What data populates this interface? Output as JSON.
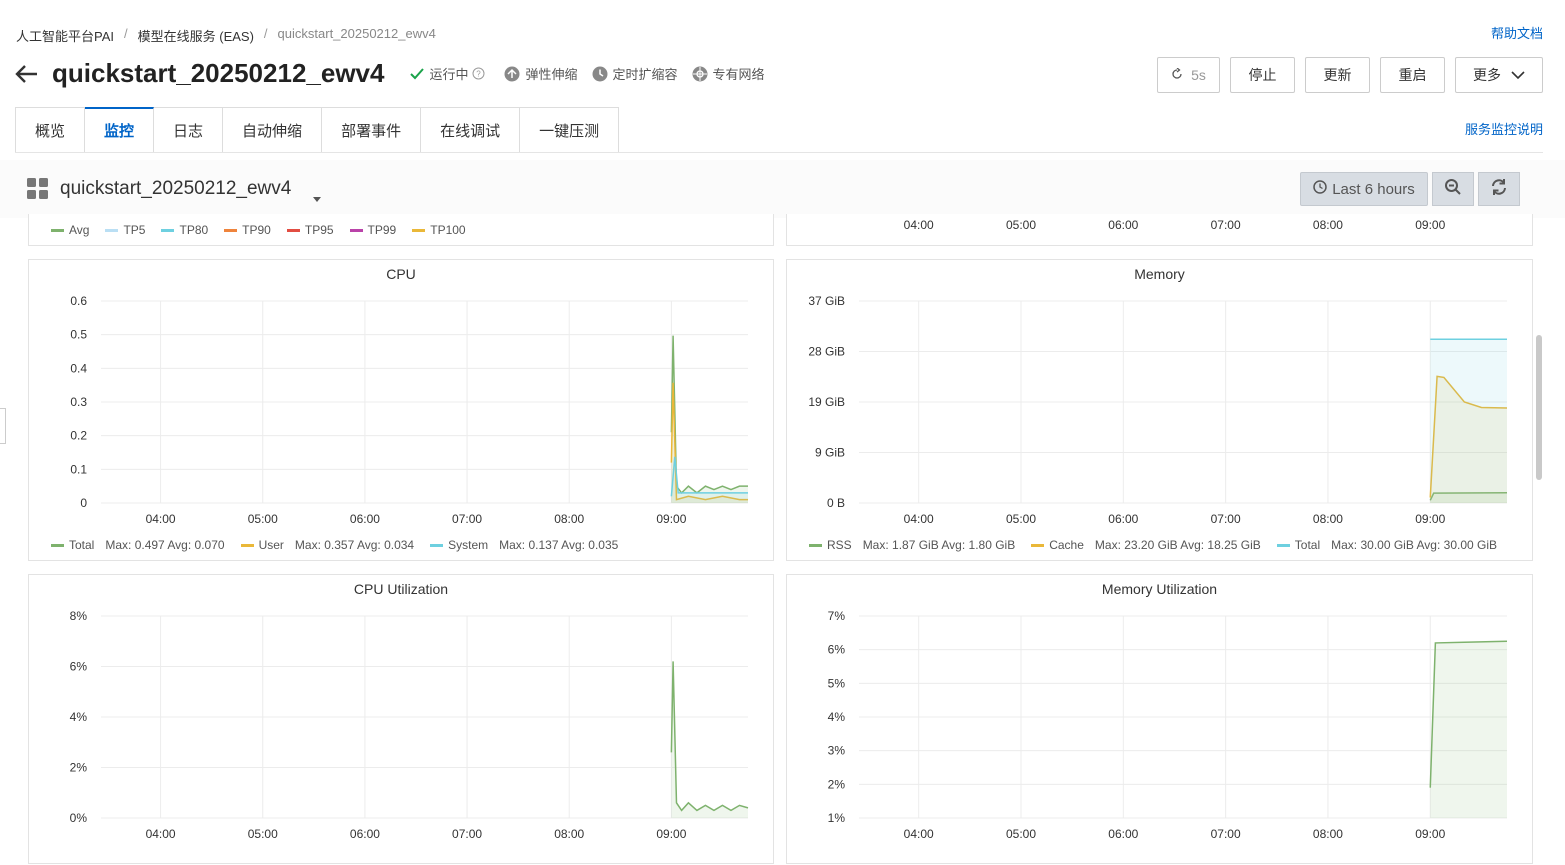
{
  "breadcrumb": {
    "item1": "人工智能平台PAI",
    "sep": "/",
    "item2": "模型在线服务 (EAS)",
    "item3": "quickstart_20250212_ewv4"
  },
  "help_link": "帮助文档",
  "service": {
    "name": "quickstart_20250212_ewv4"
  },
  "status": {
    "running": "运行中",
    "autoscale": "弹性伸缩",
    "scheduled": "定时扩缩容",
    "vpc": "专有网络"
  },
  "buttons": {
    "refresh_interval": "5s",
    "stop": "停止",
    "update": "更新",
    "restart": "重启",
    "more": "更多"
  },
  "tabs": [
    "概览",
    "监控",
    "日志",
    "自动伸缩",
    "部署事件",
    "在线调试",
    "一键压测"
  ],
  "active_tab": "监控",
  "monitor_doc_link": "服务监控说明",
  "dashboard": {
    "title": "quickstart_20250212_ewv4",
    "time_range": "Last 6 hours"
  },
  "colors": {
    "green": "#7eb26d",
    "yellow": "#eab839",
    "cyan": "#6ed0e0",
    "lightblue": "#badff4",
    "orange": "#ef843c",
    "red": "#e24d42",
    "purple": "#ba43a9",
    "link": "#0064c8"
  },
  "x_ticks": [
    "04:00",
    "05:00",
    "06:00",
    "07:00",
    "08:00",
    "09:00"
  ],
  "top_left_legend": [
    {
      "name": "Avg",
      "color": "#7eb26d"
    },
    {
      "name": "TP5",
      "color": "#badff4"
    },
    {
      "name": "TP80",
      "color": "#6ed0e0"
    },
    {
      "name": "TP90",
      "color": "#ef843c"
    },
    {
      "name": "TP95",
      "color": "#e24d42"
    },
    {
      "name": "TP99",
      "color": "#ba43a9"
    },
    {
      "name": "TP100",
      "color": "#eab839"
    }
  ],
  "panels": {
    "cpu": {
      "title": "CPU",
      "legend": [
        {
          "name": "Total",
          "stats": "Max: 0.497   Avg: 0.070",
          "color": "#7eb26d"
        },
        {
          "name": "User",
          "stats": "Max: 0.357   Avg: 0.034",
          "color": "#eab839"
        },
        {
          "name": "System",
          "stats": "Max: 0.137   Avg: 0.035",
          "color": "#6ed0e0"
        }
      ]
    },
    "memory": {
      "title": "Memory",
      "legend": [
        {
          "name": "RSS",
          "stats": "Max: 1.87 GiB   Avg: 1.80 GiB",
          "color": "#7eb26d"
        },
        {
          "name": "Cache",
          "stats": "Max: 23.20 GiB   Avg: 18.25 GiB",
          "color": "#eab839"
        },
        {
          "name": "Total",
          "stats": "Max: 30.00 GiB   Avg: 30.00 GiB",
          "color": "#6ed0e0"
        }
      ]
    },
    "cpu_util": {
      "title": "CPU Utilization"
    },
    "mem_util": {
      "title": "Memory Utilization"
    }
  },
  "chart_data": [
    {
      "type": "line",
      "title": "CPU",
      "x_ticks": [
        "04:00",
        "05:00",
        "06:00",
        "07:00",
        "08:00",
        "09:00"
      ],
      "y_ticks": [
        "0",
        "0.1",
        "0.2",
        "0.3",
        "0.4",
        "0.5",
        "0.6"
      ],
      "ylim": [
        0,
        0.6
      ],
      "series": [
        {
          "name": "Total",
          "color": "#7eb26d",
          "points": [
            [
              "09:00",
              0.21
            ],
            [
              "09:01",
              0.497
            ],
            [
              "09:03",
              0.05
            ],
            [
              "09:06",
              0.03
            ],
            [
              "09:10",
              0.05
            ],
            [
              "09:15",
              0.03
            ],
            [
              "09:20",
              0.05
            ],
            [
              "09:25",
              0.04
            ],
            [
              "09:30",
              0.05
            ],
            [
              "09:35",
              0.04
            ],
            [
              "09:40",
              0.05
            ],
            [
              "09:45",
              0.05
            ]
          ]
        },
        {
          "name": "User",
          "color": "#eab839",
          "points": [
            [
              "09:00",
              0.12
            ],
            [
              "09:01",
              0.357
            ],
            [
              "09:03",
              0.01
            ],
            [
              "09:10",
              0.02
            ],
            [
              "09:20",
              0.01
            ],
            [
              "09:30",
              0.02
            ],
            [
              "09:40",
              0.01
            ],
            [
              "09:45",
              0.01
            ]
          ]
        },
        {
          "name": "System",
          "color": "#6ed0e0",
          "points": [
            [
              "09:00",
              0.02
            ],
            [
              "09:02",
              0.137
            ],
            [
              "09:04",
              0.03
            ],
            [
              "09:10",
              0.03
            ],
            [
              "09:20",
              0.03
            ],
            [
              "09:30",
              0.03
            ],
            [
              "09:40",
              0.03
            ],
            [
              "09:45",
              0.03
            ]
          ]
        }
      ]
    },
    {
      "type": "line",
      "title": "Memory",
      "x_ticks": [
        "04:00",
        "05:00",
        "06:00",
        "07:00",
        "08:00",
        "09:00"
      ],
      "y_ticks": [
        "0 B",
        "9 GiB",
        "19 GiB",
        "28 GiB",
        "37 GiB"
      ],
      "ylim": [
        0,
        37
      ],
      "series": [
        {
          "name": "RSS",
          "color": "#7eb26d",
          "points": [
            [
              "09:00",
              0.5
            ],
            [
              "09:02",
              1.8
            ],
            [
              "09:45",
              1.87
            ]
          ]
        },
        {
          "name": "Cache",
          "color": "#eab839",
          "points": [
            [
              "09:00",
              1.0
            ],
            [
              "09:04",
              23.2
            ],
            [
              "09:08",
              23.0
            ],
            [
              "09:20",
              18.5
            ],
            [
              "09:30",
              17.5
            ],
            [
              "09:45",
              17.4
            ]
          ]
        },
        {
          "name": "Total",
          "color": "#6ed0e0",
          "points": [
            [
              "09:00",
              30.0
            ],
            [
              "09:45",
              30.0
            ]
          ]
        }
      ]
    },
    {
      "type": "line",
      "title": "CPU Utilization",
      "x_ticks": [
        "04:00",
        "05:00",
        "06:00",
        "07:00",
        "08:00",
        "09:00"
      ],
      "y_ticks": [
        "0%",
        "2%",
        "4%",
        "6%",
        "8%"
      ],
      "ylim": [
        0,
        8
      ],
      "series": [
        {
          "name": "",
          "color": "#7eb26d",
          "points": [
            [
              "09:00",
              2.6
            ],
            [
              "09:01",
              6.2
            ],
            [
              "09:03",
              0.6
            ],
            [
              "09:06",
              0.3
            ],
            [
              "09:10",
              0.6
            ],
            [
              "09:15",
              0.3
            ],
            [
              "09:20",
              0.5
            ],
            [
              "09:25",
              0.3
            ],
            [
              "09:30",
              0.5
            ],
            [
              "09:35",
              0.3
            ],
            [
              "09:40",
              0.5
            ],
            [
              "09:45",
              0.4
            ]
          ]
        }
      ]
    },
    {
      "type": "line",
      "title": "Memory Utilization",
      "x_ticks": [
        "04:00",
        "05:00",
        "06:00",
        "07:00",
        "08:00",
        "09:00"
      ],
      "y_ticks": [
        "1%",
        "2%",
        "3%",
        "4%",
        "5%",
        "6%",
        "7%"
      ],
      "ylim": [
        1,
        7
      ],
      "series": [
        {
          "name": "",
          "color": "#7eb26d",
          "points": [
            [
              "09:00",
              1.9
            ],
            [
              "09:03",
              6.2
            ],
            [
              "09:20",
              6.22
            ],
            [
              "09:45",
              6.25
            ]
          ]
        }
      ]
    }
  ]
}
